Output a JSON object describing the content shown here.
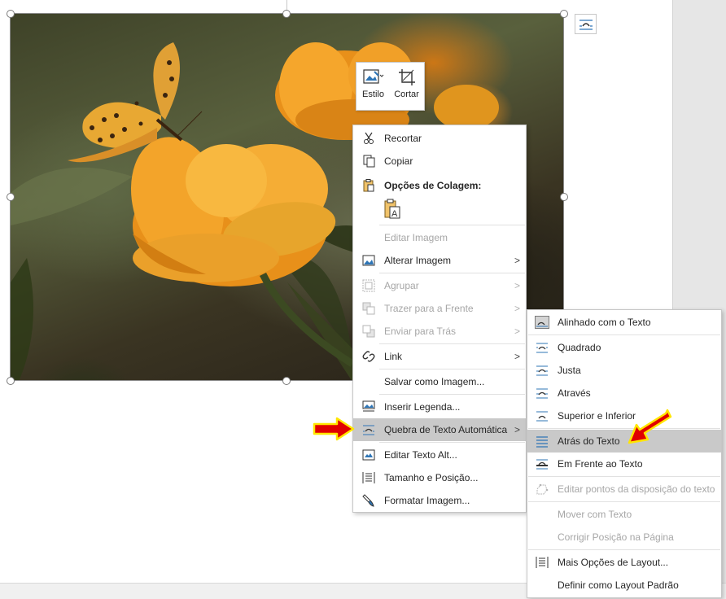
{
  "mini_toolbar": {
    "style_label": "Estilo",
    "crop_label": "Cortar"
  },
  "context_menu": {
    "cut": "Recortar",
    "copy": "Copiar",
    "paste_options": "Opções de Colagem:",
    "edit_image": "Editar Imagem",
    "change_image": "Alterar Imagem",
    "group": "Agrupar",
    "bring_forward": "Trazer para a Frente",
    "send_backward": "Enviar para Trás",
    "link": "Link",
    "save_as_image": "Salvar como Imagem...",
    "insert_caption": "Inserir Legenda...",
    "wrap_text": "Quebra de Texto Automática",
    "edit_alt_text": "Editar Texto Alt...",
    "size_position": "Tamanho e Posição...",
    "format_image": "Formatar Imagem...",
    "arrow_glyph": ">"
  },
  "wrap_submenu": {
    "inline": "Alinhado com o Texto",
    "square": "Quadrado",
    "tight": "Justa",
    "through": "Através",
    "top_bottom": "Superior e Inferior",
    "behind_text": "Atrás do Texto",
    "in_front": "Em Frente ao Texto",
    "edit_wrap_points": "Editar pontos da disposição do texto",
    "move_with_text": "Mover com Texto",
    "fix_position": "Corrigir Posição na Página",
    "more_layout": "Mais Opções de Layout...",
    "set_default": "Definir como Layout Padrão"
  },
  "colors": {
    "highlight": "#c9c9c9",
    "accent": "#2e75b6",
    "annotation_red": "#e00000",
    "annotation_yellow": "#ffe600"
  }
}
